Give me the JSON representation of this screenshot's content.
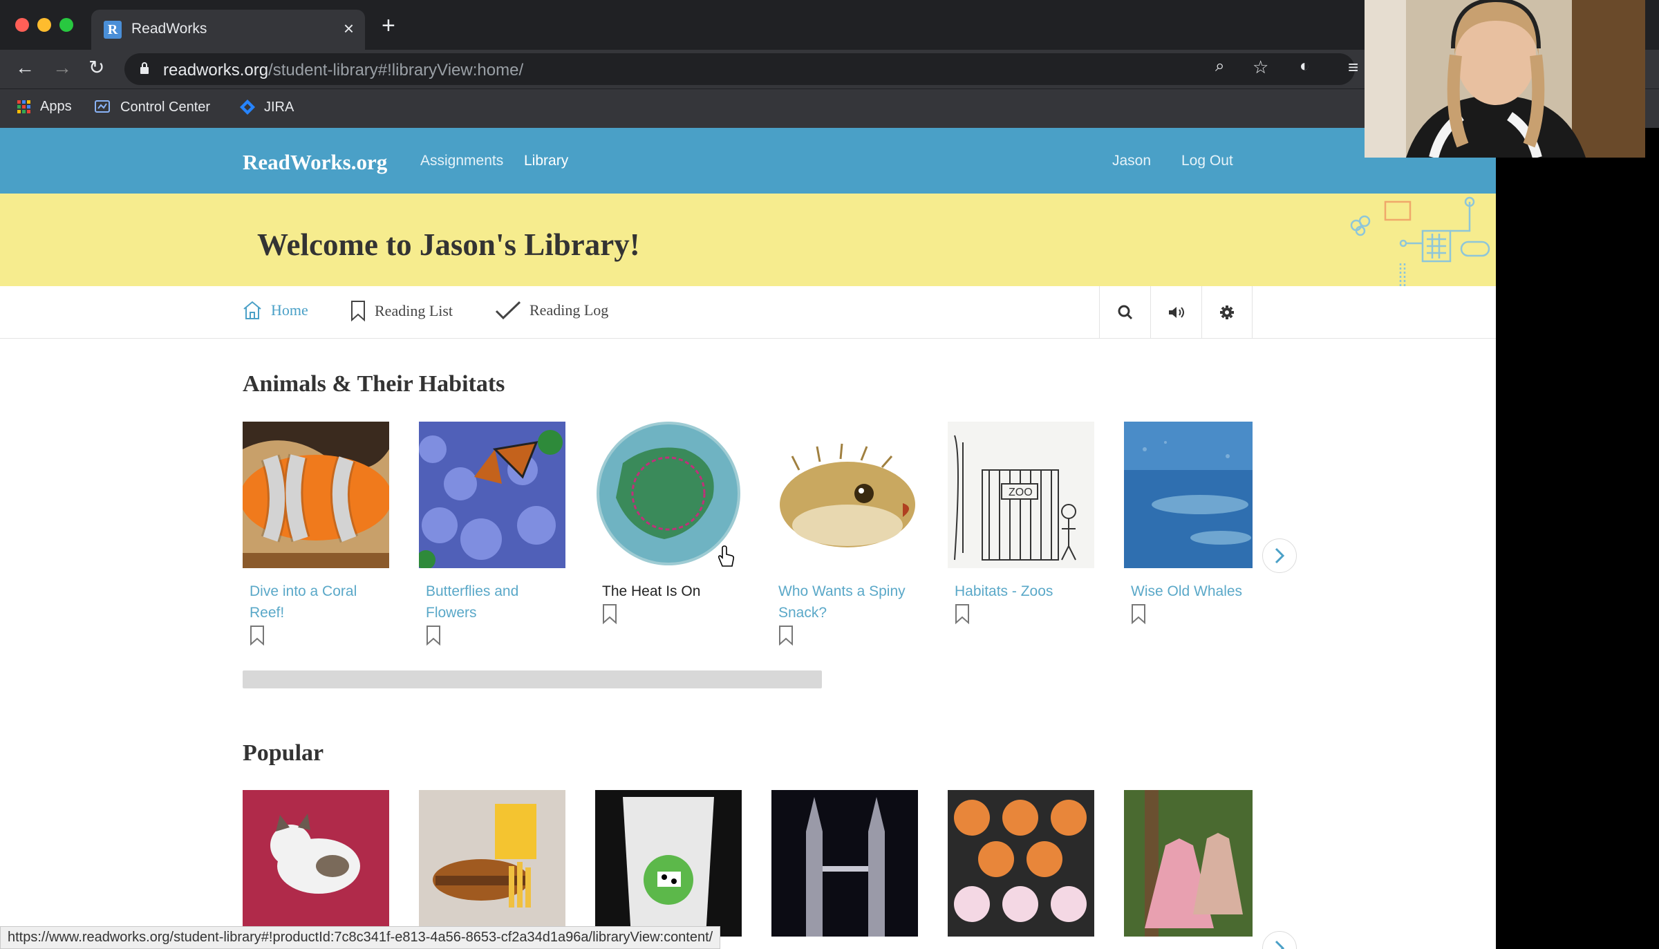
{
  "browser": {
    "tab_title": "ReadWorks",
    "url_host": "readworks.org",
    "url_path": "/student-library#!libraryView:home/",
    "bookmarks": [
      "Apps",
      "Control Center",
      "JIRA"
    ],
    "status_url": "https://www.readworks.org/student-library#!productId:7c8c341f-e813-4a56-8653-cf2a34d1a96a/libraryView:content/"
  },
  "header": {
    "logo": "ReadWorks.org",
    "nav": [
      "Assignments",
      "Library"
    ],
    "user": "Jason",
    "logout": "Log Out"
  },
  "welcome": {
    "title": "Welcome to Jason's Library!"
  },
  "subnav": {
    "home": "Home",
    "reading_list": "Reading List",
    "reading_log": "Reading Log"
  },
  "sections": {
    "habitats": {
      "title": "Animals & Their Habitats",
      "items": [
        {
          "title": "Dive into a Coral Reef!"
        },
        {
          "title": "Butterflies and Flowers"
        },
        {
          "title": "The Heat Is On"
        },
        {
          "title": "Who Wants a Spiny Snack?"
        },
        {
          "title": "Habitats - Zoos"
        },
        {
          "title": "Wise Old Whales"
        }
      ]
    },
    "popular": {
      "title": "Popular"
    }
  },
  "colors": {
    "header": "#4aa0c7",
    "welcome": "#f6ec8e",
    "link": "#5aa8c8"
  }
}
